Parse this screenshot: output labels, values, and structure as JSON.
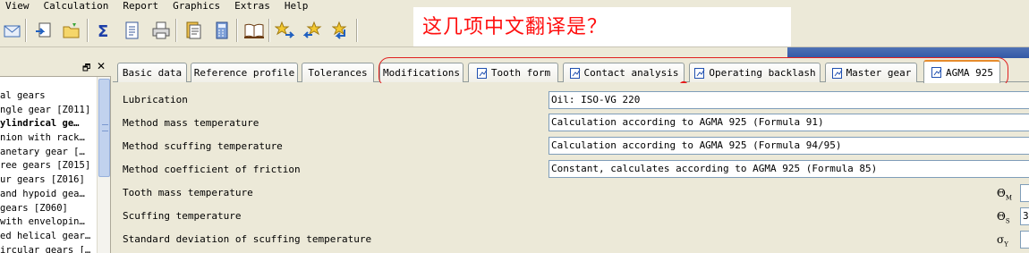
{
  "menu": [
    "View",
    "Calculation",
    "Report",
    "Graphics",
    "Extras",
    "Help"
  ],
  "toolbar": {
    "buttons": [
      "mail-icon",
      "export-icon",
      "open-folder-icon",
      "sum-icon",
      "document-icon",
      "print-icon",
      "report-icon",
      "calculator-icon",
      "book-icon",
      "star-arrow-icon",
      "star-back-icon",
      "star-return-icon"
    ]
  },
  "annotation": {
    "question": "这几项中文翻译是？",
    "color": "#ff1010"
  },
  "left_panel": {
    "items": [
      {
        "label": "al gears",
        "bold": false
      },
      {
        "label": "ngle gear [Z011]",
        "bold": false
      },
      {
        "label": "ylindrical ge…",
        "bold": true
      },
      {
        "label": "nion with rack…",
        "bold": false
      },
      {
        "label": "anetary gear […",
        "bold": false
      },
      {
        "label": "ree gears [Z015]",
        "bold": false
      },
      {
        "label": "ur gears [Z016]",
        "bold": false
      },
      {
        "label": " and hypoid gea…",
        "bold": false
      },
      {
        "label": "gears [Z060]",
        "bold": false
      },
      {
        "label": " with envelopin…",
        "bold": false
      },
      {
        "label": "ed helical gear…",
        "bold": false
      },
      {
        "label": "ircular gears […",
        "bold": false
      }
    ]
  },
  "tabs": [
    {
      "label": "Basic data",
      "icon": false,
      "active": false
    },
    {
      "label": "Reference profile",
      "icon": false,
      "active": false
    },
    {
      "label": "Tolerances",
      "icon": false,
      "active": false
    },
    {
      "label": "Modifications",
      "icon": false,
      "active": false
    },
    {
      "label": "Tooth form",
      "icon": true,
      "active": false
    },
    {
      "label": "Contact analysis",
      "icon": true,
      "active": false
    },
    {
      "label": "Operating backlash",
      "icon": true,
      "active": false
    },
    {
      "label": "Master gear",
      "icon": true,
      "active": false
    },
    {
      "label": "AGMA 925",
      "icon": true,
      "active": true
    }
  ],
  "rows": [
    {
      "label": "Lubrication",
      "value": "Oil: ISO-VG 220"
    },
    {
      "label": "Method mass temperature",
      "value": "Calculation according to AGMA 925 (Formula 91)"
    },
    {
      "label": "Method scuffing temperature",
      "value": "Calculation according to AGMA 925 (Formula 94/95)"
    },
    {
      "label": "Method coefficient of friction",
      "value": "Constant, calculates according to AGMA 925 (Formula 85)"
    },
    {
      "label": "Tooth mass temperature",
      "symbol": "Θ",
      "sub": "M",
      "box": ""
    },
    {
      "label": "Scuffing temperature",
      "symbol": "Θ",
      "sub": "S",
      "box": "3"
    },
    {
      "label": "Standard deviation of scuffing temperature",
      "symbol": "σ",
      "sub": "Y",
      "box": ""
    }
  ]
}
